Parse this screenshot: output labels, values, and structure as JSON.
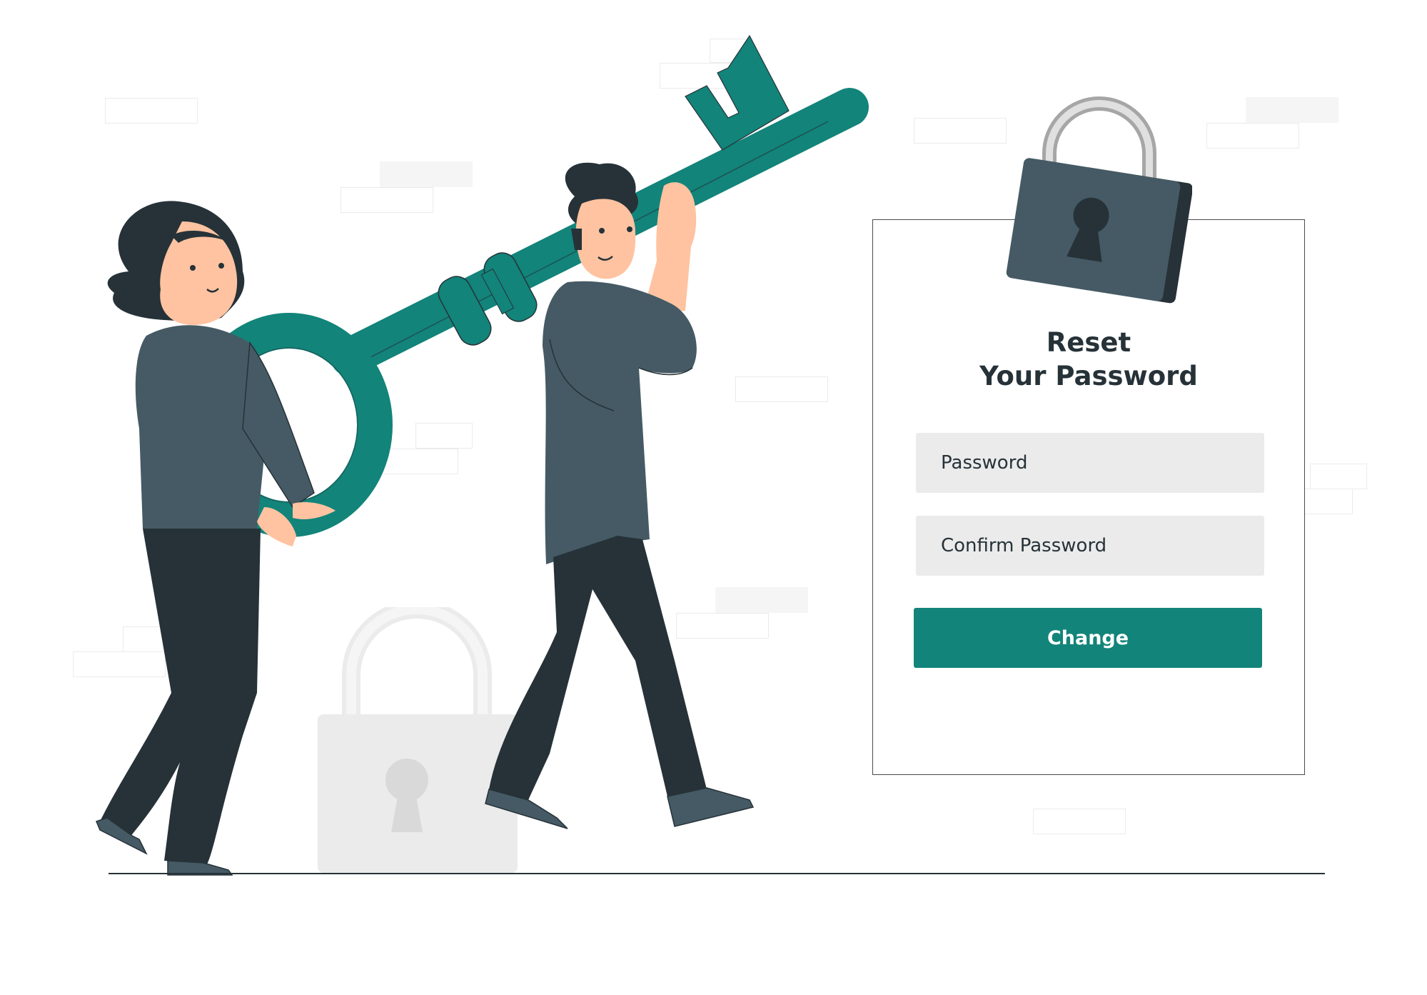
{
  "reset_card": {
    "title": "Reset\nYour Password",
    "password_placeholder": "Password",
    "confirm_placeholder": "Confirm Password",
    "change_label": "Change"
  },
  "colors": {
    "accent": "#12847a",
    "dark": "#263238",
    "shirt": "#455a64",
    "skin": "#ffc3a1",
    "field_bg": "#ebebeb"
  },
  "icons": [
    "padlock-icon",
    "key-icon",
    "keyhole-icon"
  ]
}
